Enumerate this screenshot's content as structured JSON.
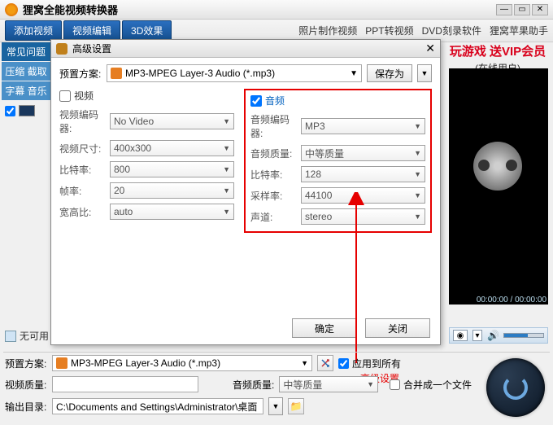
{
  "titlebar": {
    "title": "狸窝全能视频转换器"
  },
  "toolstrip": {
    "buttons": [
      "添加视频",
      "视频编辑",
      "3D效果"
    ],
    "rightlinks": [
      "照片制作视频",
      "PPT转视频",
      "DVD刻录软件",
      "狸窝苹果助手"
    ]
  },
  "promo": {
    "line1": "玩游戏  送VIP会员",
    "line2": "(在线用户)"
  },
  "leftcol": {
    "sections": [
      "常见问题",
      "压缩 截取",
      "字幕 音乐"
    ]
  },
  "dialog": {
    "title": "高级设置",
    "preset_label": "预置方案:",
    "preset_value": "MP3-MPEG Layer-3 Audio (*.mp3)",
    "save_as": "保存为",
    "video": {
      "title": "视频",
      "rows": [
        {
          "label": "视频编码器:",
          "value": "No Video"
        },
        {
          "label": "视频尺寸:",
          "value": "400x300"
        },
        {
          "label": "比特率:",
          "value": "800"
        },
        {
          "label": "帧率:",
          "value": "20"
        },
        {
          "label": "宽高比:",
          "value": "auto"
        }
      ]
    },
    "audio": {
      "title": "音频",
      "rows": [
        {
          "label": "音频编码器:",
          "value": "MP3"
        },
        {
          "label": "音频质量:",
          "value": "中等质量"
        },
        {
          "label": "比特率:",
          "value": "128"
        },
        {
          "label": "采样率:",
          "value": "44100"
        },
        {
          "label": "声道:",
          "value": "stereo"
        }
      ]
    },
    "ok": "确定",
    "cancel": "关闭"
  },
  "annotation": {
    "label": "高级设置"
  },
  "player": {
    "time": "00:00:00 / 00:00:00"
  },
  "bottom": {
    "preset_label": "预置方案:",
    "preset_value": "MP3-MPEG Layer-3 Audio (*.mp3)",
    "apply_all": "应用到所有",
    "video_quality_label": "视频质量:",
    "video_quality_value": "",
    "audio_quality_label": "音频质量:",
    "audio_quality_value": "中等质量",
    "merge": "合并成一个文件",
    "outdir_label": "输出目录:",
    "outdir_value": "C:\\Documents and Settings\\Administrator\\桌面"
  },
  "leftbtm": {
    "label": "无可用"
  }
}
